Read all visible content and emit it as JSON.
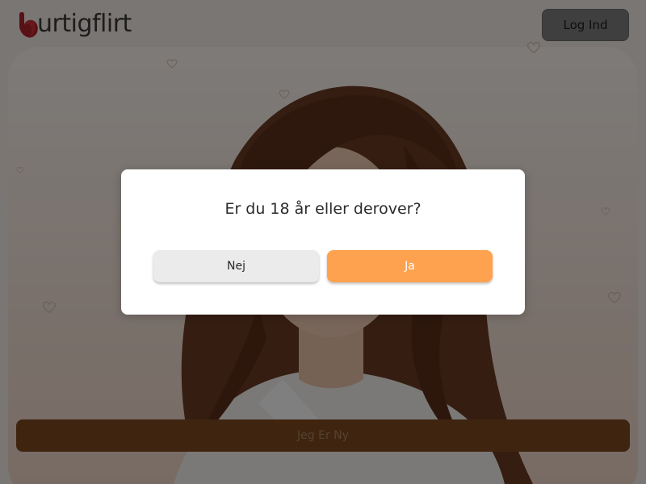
{
  "header": {
    "logo_text": "hurtigflirt",
    "logo_display_text": "urtigflirt",
    "login_label": "Log Ind"
  },
  "main": {
    "signup_label": "Jeg Er Ny"
  },
  "age_modal": {
    "question": "Er du 18 år eller derover?",
    "no_label": "Nej",
    "yes_label": "Ja"
  },
  "colors": {
    "brand_red": "#c0262d",
    "accent_orange": "#ffa24f",
    "overlay": "rgba(0,0,0,0.5)"
  }
}
